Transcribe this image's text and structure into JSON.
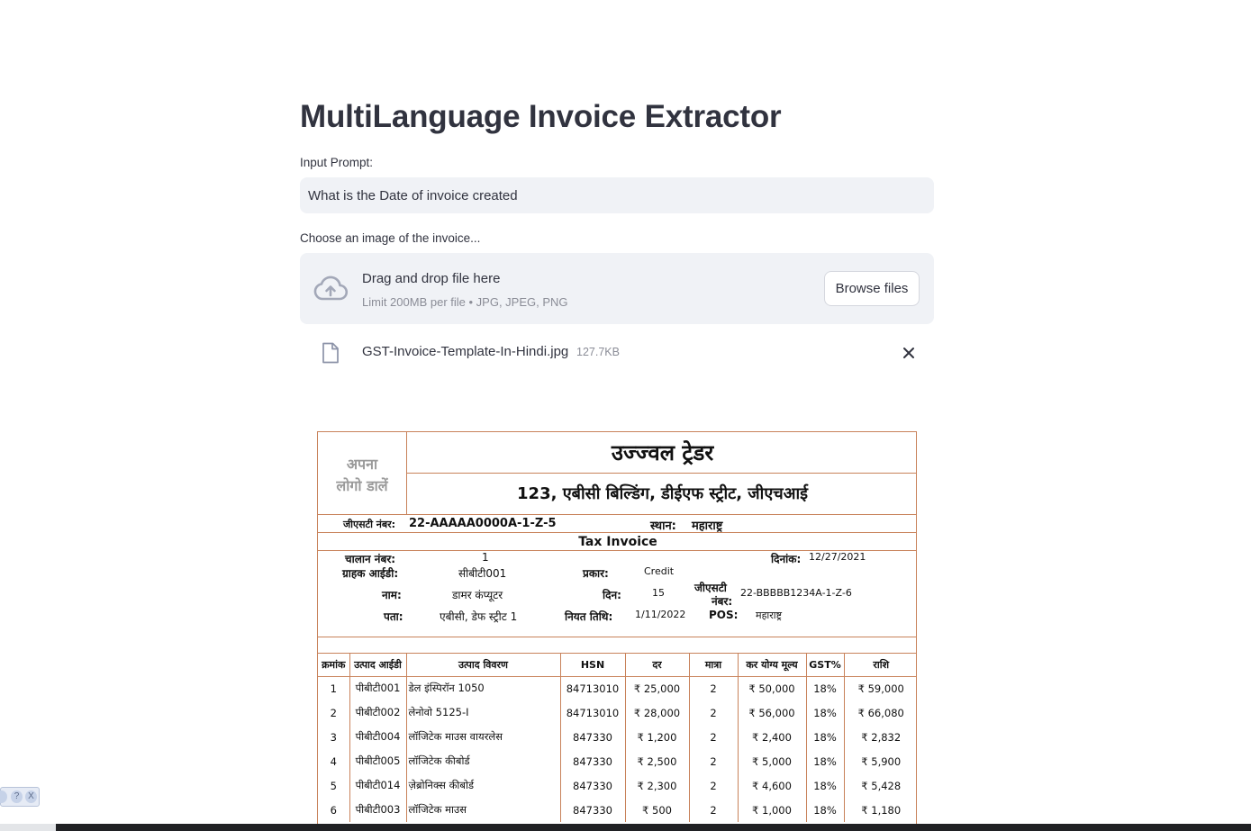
{
  "app": {
    "title": "MultiLanguage Invoice Extractor"
  },
  "prompt": {
    "label": "Input Prompt:",
    "value": "What is the Date of invoice created"
  },
  "uploader": {
    "label": "Choose an image of the invoice...",
    "drag_text": "Drag and drop file here",
    "limit_text": "Limit 200MB per file • JPG, JPEG, PNG",
    "browse_label": "Browse files",
    "icon": "cloud-upload-icon"
  },
  "uploaded_file": {
    "name": "GST-Invoice-Template-In-Hindi.jpg",
    "size": "127.7KB",
    "icon": "file-icon",
    "remove_icon": "close-icon"
  },
  "invoice": {
    "logo_line1": "अपना",
    "logo_line2": "लोगो डालें",
    "company": "उज्ज्वल ट्रेडर",
    "address": "123, एबीसी बिल्डिंग, डीईएफ स्ट्रीट, जीएचआई",
    "gst_label": "जीएसटी नंबर:",
    "gst_value": "22-AAAAA0000A-1-Z-5",
    "place_label": "स्थान:",
    "place_value": "महाराष्ट्र",
    "doc_title": "Tax Invoice",
    "challan_label": "चालान नंबर:",
    "challan_value": "1",
    "date_label": "दिनांक:",
    "date_value": "12/27/2021",
    "customer_id_label": "ग्राहक आईडी:",
    "customer_id_value": "सीबीटी001",
    "type_label": "प्रकार:",
    "type_value": "Credit",
    "name_label": "नाम:",
    "name_value": "डामर कंप्यूटर",
    "days_label": "दिन:",
    "days_value": "15",
    "cust_gst_label1": "जीएसटी",
    "cust_gst_label2": "नंबर:",
    "cust_gst_value": "22-BBBBB1234A-1-Z-6",
    "address_label": "पता:",
    "address_value": "एबीसी, डेफ स्ट्रीट 1",
    "due_label": "नियत तिथि:",
    "due_value": "1/11/2022",
    "pos_label": "POS:",
    "pos_value": "महाराष्ट्र",
    "columns": [
      "क्रमांक",
      "उत्पाद आईडी",
      "उत्पाद विवरण",
      "HSN",
      "दर",
      "मात्रा",
      "कर योग्य मूल्य",
      "GST%",
      "राशि"
    ],
    "rows": [
      [
        "1",
        "पीबीटी001",
        "डेल इंस्पिरॉन 1050",
        "84713010",
        "₹ 25,000",
        "2",
        "₹ 50,000",
        "18%",
        "₹ 59,000"
      ],
      [
        "2",
        "पीबीटी002",
        "लेनोवो 5125-I",
        "84713010",
        "₹ 28,000",
        "2",
        "₹ 56,000",
        "18%",
        "₹ 66,080"
      ],
      [
        "3",
        "पीबीटी004",
        "लॉजिटेक माउस वायरलेस",
        "847330",
        "₹ 1,200",
        "2",
        "₹ 2,400",
        "18%",
        "₹ 2,832"
      ],
      [
        "4",
        "पीबीटी005",
        "लॉजिटेक कीबोर्ड",
        "847330",
        "₹ 2,500",
        "2",
        "₹ 5,000",
        "18%",
        "₹ 5,900"
      ],
      [
        "5",
        "पीबीटी014",
        "ज़ेब्रोनिक्स कीबोर्ड",
        "847330",
        "₹ 2,300",
        "2",
        "₹ 4,600",
        "18%",
        "₹ 5,428"
      ],
      [
        "6",
        "पीबीटी003",
        "लॉजिटेक माउस",
        "847330",
        "₹ 500",
        "2",
        "₹ 1,000",
        "18%",
        "₹ 1,180"
      ]
    ]
  },
  "widget": {
    "help_glyph": "?",
    "close_glyph": "X"
  }
}
